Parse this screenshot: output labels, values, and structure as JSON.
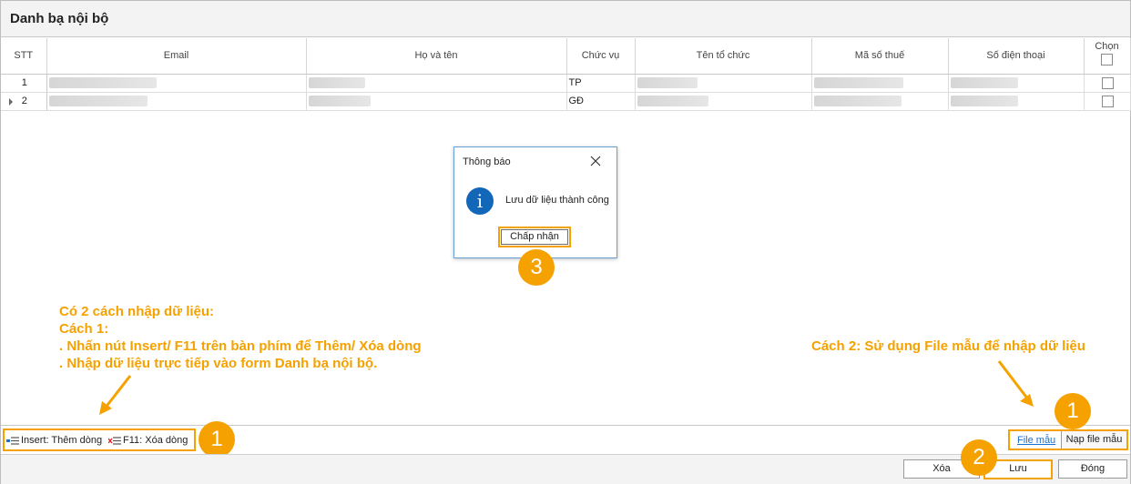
{
  "window": {
    "title": "Danh bạ nội bộ"
  },
  "table": {
    "headers": {
      "stt": "STT",
      "email": "Email",
      "name": "Họ và tên",
      "position": "Chức vụ",
      "org": "Tên tổ chức",
      "tax": "Mã số thuế",
      "phone": "Số điện thoại",
      "select": "Chọn"
    },
    "rows": [
      {
        "stt": "1",
        "position": "TP"
      },
      {
        "stt": "2",
        "position": "GĐ"
      }
    ]
  },
  "dialog": {
    "title": "Thông báo",
    "message": "Lưu dữ liệu thành công",
    "ok_label": "Chấp nhận",
    "info_glyph": "i",
    "close_glyph": "✕"
  },
  "annotations": {
    "left_lines": [
      "Có 2 cách nhập dữ liệu:",
      "Cách 1:",
      ". Nhấn nút Insert/ F11 trên bàn phím để Thêm/ Xóa dòng",
      ". Nhập dữ liệu trực tiếp vào form Danh bạ nội bộ."
    ],
    "right_text": "Cách 2: Sử dụng File mẫu để nhập dữ liệu",
    "badges": {
      "one": "1",
      "two": "2",
      "three": "3"
    },
    "accent_color": "#f5a100"
  },
  "hotkeys": {
    "insert_label": "Insert: Thêm dòng",
    "delete_label": "F11: Xóa dòng"
  },
  "file_tools": {
    "template_link": "File mẫu",
    "load_button": "Nạp file mẫu"
  },
  "footer": {
    "delete_button": "Xóa",
    "save_button": "Lưu",
    "close_button": "Đóng"
  }
}
